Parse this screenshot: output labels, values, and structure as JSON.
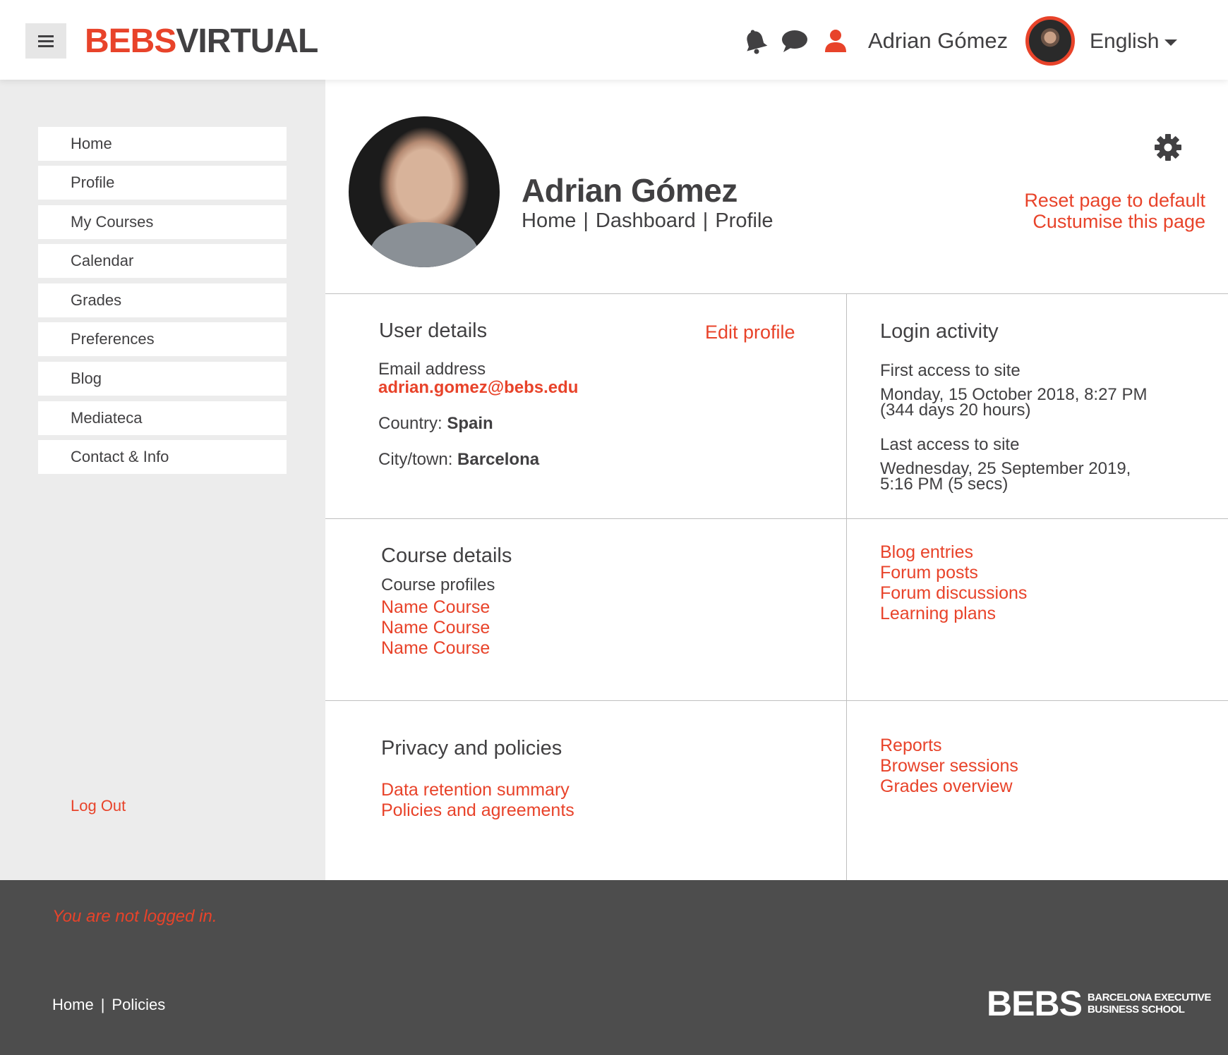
{
  "header": {
    "logo_part1": "BEBS",
    "logo_part2": "VIRTUAL",
    "user_name": "Adrian Gómez",
    "language": "English",
    "icons": [
      "notification-bell-icon",
      "chat-icon",
      "user-icon",
      "chevron-down-icon",
      "menu-icon"
    ]
  },
  "sidebar": {
    "items": [
      {
        "label": "Home"
      },
      {
        "label": "Profile"
      },
      {
        "label": "My Courses"
      },
      {
        "label": "Calendar"
      },
      {
        "label": "Grades"
      },
      {
        "label": "Preferences"
      },
      {
        "label": "Blog"
      },
      {
        "label": "Mediateca"
      },
      {
        "label": "Contact & Info"
      }
    ],
    "logout": "Log Out"
  },
  "profile": {
    "name": "Adrian Gómez",
    "breadcrumb": [
      "Home",
      "Dashboard",
      "Profile"
    ],
    "breadcrumb_sep": "|",
    "reset_link": "Reset page to default",
    "customise_link": "Custumise this page"
  },
  "user_details": {
    "title": "User details",
    "edit_link": "Edit profile",
    "email_label": "Email address",
    "email": "adrian.gomez@bebs.edu",
    "country_label": "Country:",
    "country": "Spain",
    "city_label": "City/town:",
    "city": "Barcelona"
  },
  "login_activity": {
    "title": "Login activity",
    "first_label": "First access to site",
    "first_value": "Monday, 15 October 2018, 8:27 PM",
    "first_since": "(344 days 20 hours)",
    "last_label": "Last access to site",
    "last_value": "Wednesday, 25 September 2019,",
    "last_value2": "5:16 PM  (5 secs)"
  },
  "course_details": {
    "title": "Course details",
    "subtitle": "Course profiles",
    "courses": [
      "Name Course",
      "Name Course",
      "Name Course"
    ]
  },
  "misc_links": [
    "Blog entries",
    "Forum posts",
    "Forum discussions",
    "Learning plans"
  ],
  "privacy": {
    "title": "Privacy and policies",
    "links": [
      "Data retention summary",
      "Policies and agreements"
    ]
  },
  "reports_links": [
    "Reports",
    "Browser sessions",
    "Grades overview"
  ],
  "footer": {
    "not_logged": "You are not logged in.",
    "links": [
      "Home",
      "Policies"
    ],
    "sep": "|",
    "logo_big": "BEBS",
    "logo_small1": "BARCELONA EXECUTIVE",
    "logo_small2": "BUSINESS SCHOOL"
  },
  "colors": {
    "accent": "#e8432a",
    "text": "#414042",
    "sidebar_bg": "#ececec",
    "footer_bg": "#4d4d4d"
  }
}
